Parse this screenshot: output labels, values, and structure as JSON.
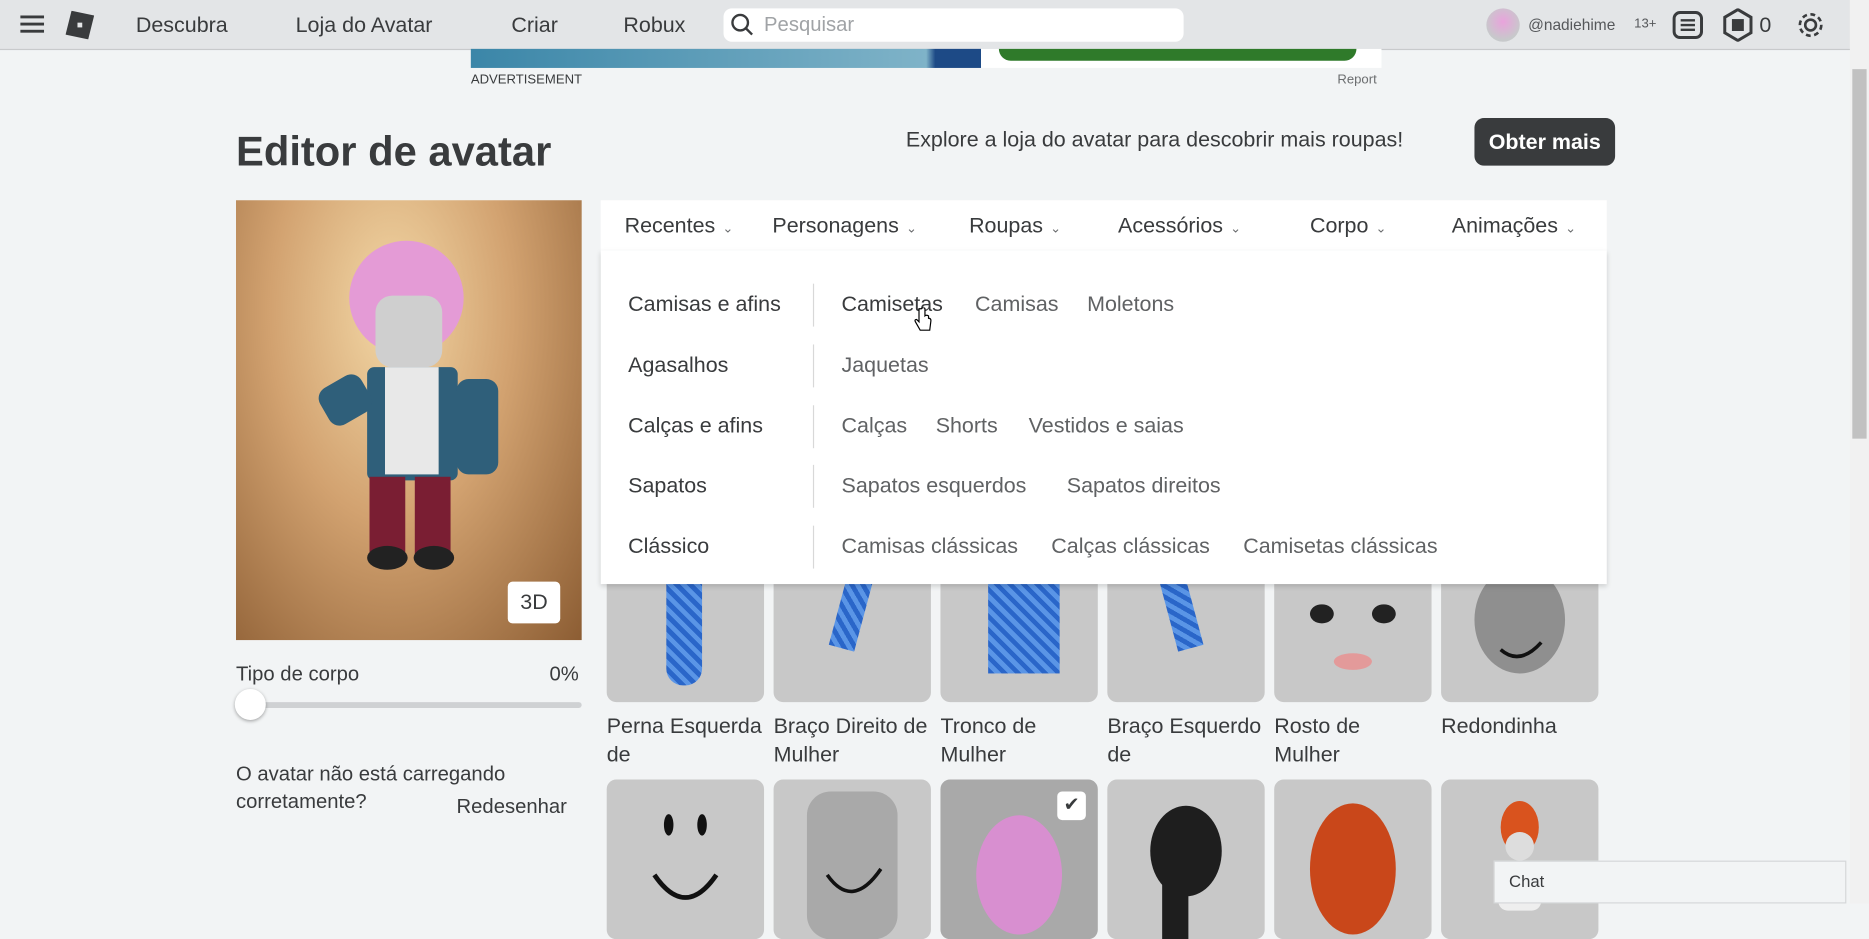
{
  "topbar": {
    "nav": [
      "Descubra",
      "Loja do Avatar",
      "Criar",
      "Robux"
    ],
    "search_placeholder": "Pesquisar",
    "username": "@nadiehime",
    "age_badge": "13+",
    "robux": "0"
  },
  "ad": {
    "label": "ADVERTISEMENT",
    "report": "Report"
  },
  "page": {
    "title": "Editor de avatar",
    "explore_text": "Explore a loja do avatar para descobrir mais roupas!",
    "get_more": "Obter mais",
    "btn_3d": "3D",
    "body_type_label": "Tipo de corpo",
    "body_type_value": "0%",
    "body_type_fraction": 0,
    "loading_issue": "O avatar não está carregando corretamente?",
    "redraw": "Redesenhar"
  },
  "tabs": [
    "Recentes",
    "Personagens",
    "Roupas",
    "Acessórios",
    "Corpo",
    "Animações"
  ],
  "dropdown": [
    {
      "category": "Camisas e afins",
      "items": [
        "Camisetas",
        "Camisas",
        "Moletons"
      ]
    },
    {
      "category": "Agasalhos",
      "items": [
        "Jaquetas"
      ]
    },
    {
      "category": "Calças e afins",
      "items": [
        "Calças",
        "Shorts",
        "Vestidos e saias"
      ]
    },
    {
      "category": "Sapatos",
      "items": [
        "Sapatos esquerdos",
        "Sapatos direitos"
      ]
    },
    {
      "category": "Clássico",
      "items": [
        "Camisas clássicas",
        "Calças clássicas",
        "Camisetas clássicas"
      ]
    }
  ],
  "items_row1": [
    {
      "name": "Perna Esquerda de"
    },
    {
      "name": "Braço Direito de Mulher"
    },
    {
      "name": "Tronco de Mulher"
    },
    {
      "name": "Braço Esquerdo de"
    },
    {
      "name": "Rosto de Mulher"
    },
    {
      "name": "Redondinha"
    }
  ],
  "items_row2_equipped": [
    false,
    false,
    true,
    false,
    false,
    false
  ],
  "chat": "Chat",
  "colors": {
    "topbar": "#e3e5e7",
    "background": "#f2f4f5",
    "button_dark": "#393b3d"
  }
}
